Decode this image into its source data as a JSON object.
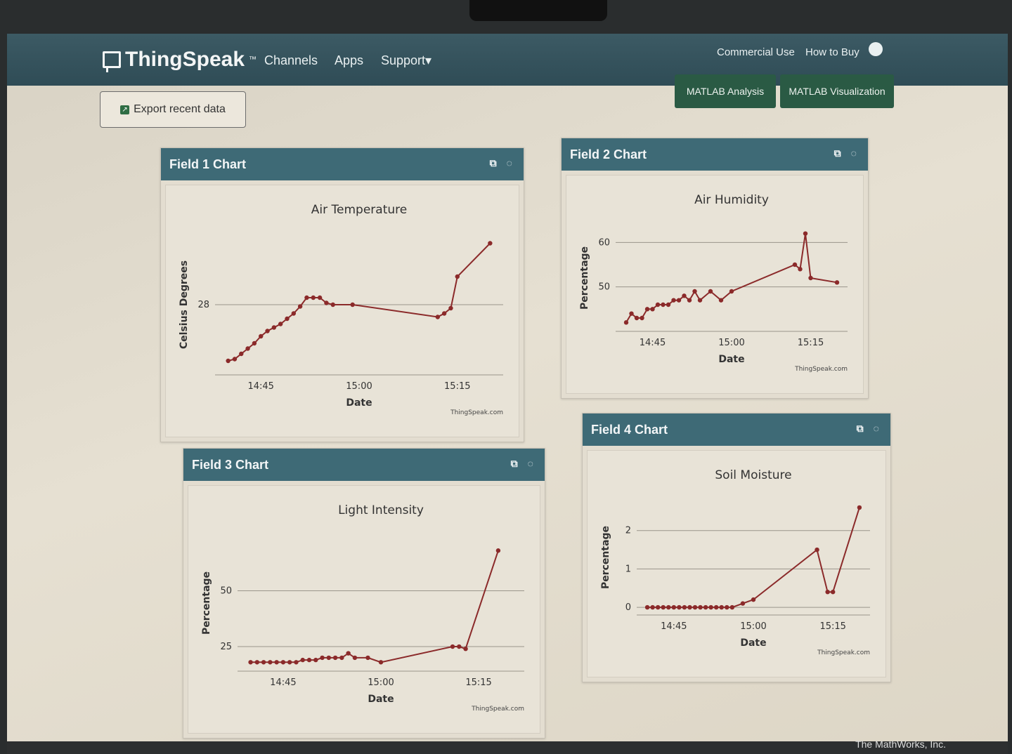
{
  "navbar": {
    "brand": "ThingSpeak",
    "brand_tm": "™",
    "links": [
      "Channels",
      "Apps",
      "Support▾"
    ],
    "right_links": [
      "Commercial Use",
      "How to Buy"
    ]
  },
  "toolbar": {
    "export_label": "Export recent data",
    "matlab_analysis": "MATLAB Analysis",
    "matlab_visualization": "MATLAB Visualization"
  },
  "footer": {
    "text": "The MathWorks, Inc."
  },
  "colors": {
    "navbar": "#2f4c56",
    "card_header": "#3e6a76",
    "series": "#8b2a2a",
    "matlab_btn": "#2a5a44"
  },
  "icons": [
    "chat-icon",
    "user-icon",
    "export-icon",
    "external-link-icon",
    "comment-icon"
  ],
  "charts": [
    {
      "header": "Field 1 Chart",
      "title": "Air Temperature",
      "ylabel": "Celsius Degrees",
      "xlabel": "Date",
      "credit": "ThingSpeak.com"
    },
    {
      "header": "Field 2 Chart",
      "title": "Air Humidity",
      "ylabel": "Percentage",
      "xlabel": "Date",
      "credit": "ThingSpeak.com"
    },
    {
      "header": "Field 3 Chart",
      "title": "Light Intensity",
      "ylabel": "Percentage",
      "xlabel": "Date",
      "credit": "ThingSpeak.com"
    },
    {
      "header": "Field 4 Chart",
      "title": "Soil Moisture",
      "ylabel": "Percentage",
      "xlabel": "Date",
      "credit": "ThingSpeak.com"
    }
  ],
  "chart_data": [
    {
      "type": "line",
      "title": "Air Temperature",
      "xlabel": "Date",
      "ylabel": "Celsius Degrees",
      "x_ticks": [
        "14:45",
        "15:00",
        "15:15"
      ],
      "y_ticks": [
        28
      ],
      "x": [
        "14:40",
        "14:41",
        "14:42",
        "14:43",
        "14:44",
        "14:45",
        "14:46",
        "14:47",
        "14:48",
        "14:49",
        "14:50",
        "14:51",
        "14:52",
        "14:53",
        "14:54",
        "14:55",
        "14:56",
        "14:59",
        "15:12",
        "15:13",
        "15:14",
        "15:15",
        "15:20"
      ],
      "values": [
        24.8,
        24.9,
        25.2,
        25.5,
        25.8,
        26.2,
        26.5,
        26.7,
        26.9,
        27.2,
        27.5,
        27.9,
        28.4,
        28.4,
        28.4,
        28.1,
        28.0,
        28.0,
        27.3,
        27.5,
        27.8,
        29.6,
        31.5
      ],
      "ylim": [
        24,
        32
      ],
      "grid": true
    },
    {
      "type": "line",
      "title": "Air Humidity",
      "xlabel": "Date",
      "ylabel": "Percentage",
      "x_ticks": [
        "14:45",
        "15:00",
        "15:15"
      ],
      "y_ticks": [
        50,
        60
      ],
      "x": [
        "14:40",
        "14:41",
        "14:42",
        "14:43",
        "14:44",
        "14:45",
        "14:46",
        "14:47",
        "14:48",
        "14:49",
        "14:50",
        "14:51",
        "14:52",
        "14:53",
        "14:54",
        "14:56",
        "14:58",
        "15:00",
        "15:12",
        "15:13",
        "15:14",
        "15:15",
        "15:20"
      ],
      "values": [
        42,
        44,
        43,
        43,
        45,
        45,
        46,
        46,
        46,
        47,
        47,
        48,
        47,
        49,
        47,
        49,
        47,
        49,
        55,
        54,
        62,
        52,
        51
      ],
      "ylim": [
        40,
        64
      ],
      "grid": true
    },
    {
      "type": "line",
      "title": "Light Intensity",
      "xlabel": "Date",
      "ylabel": "Percentage",
      "x_ticks": [
        "14:45",
        "15:00",
        "15:15"
      ],
      "y_ticks": [
        25,
        50
      ],
      "x": [
        "14:40",
        "14:41",
        "14:42",
        "14:43",
        "14:44",
        "14:45",
        "14:46",
        "14:47",
        "14:48",
        "14:49",
        "14:50",
        "14:51",
        "14:52",
        "14:53",
        "14:54",
        "14:55",
        "14:56",
        "14:58",
        "15:00",
        "15:11",
        "15:12",
        "15:13",
        "15:18"
      ],
      "values": [
        18,
        18,
        18,
        18,
        18,
        18,
        18,
        18,
        19,
        19,
        19,
        20,
        20,
        20,
        20,
        22,
        20,
        20,
        18,
        25,
        25,
        24,
        68
      ],
      "ylim": [
        14,
        75
      ],
      "grid": true
    },
    {
      "type": "line",
      "title": "Soil Moisture",
      "xlabel": "Date",
      "ylabel": "Percentage",
      "x_ticks": [
        "14:45",
        "15:00",
        "15:15"
      ],
      "y_ticks": [
        0,
        1,
        2
      ],
      "x": [
        "14:40",
        "14:41",
        "14:42",
        "14:43",
        "14:44",
        "14:45",
        "14:46",
        "14:47",
        "14:48",
        "14:49",
        "14:50",
        "14:51",
        "14:52",
        "14:53",
        "14:54",
        "14:55",
        "14:56",
        "14:58",
        "15:00",
        "15:12",
        "15:14",
        "15:15",
        "15:20"
      ],
      "values": [
        0,
        0,
        0,
        0,
        0,
        0,
        0,
        0,
        0,
        0,
        0,
        0,
        0,
        0,
        0,
        0,
        0,
        0.1,
        0.2,
        1.5,
        0.4,
        0.4,
        2.6
      ],
      "ylim": [
        -0.2,
        2.8
      ],
      "grid": true
    }
  ]
}
